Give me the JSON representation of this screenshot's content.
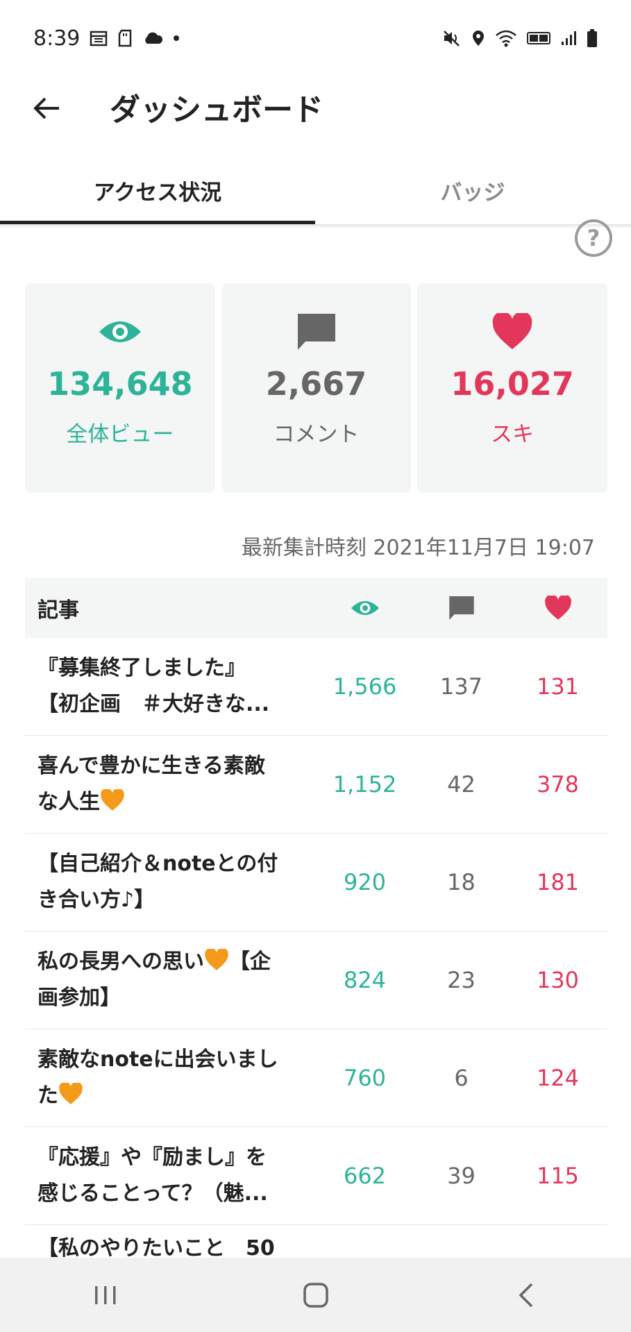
{
  "status_bar": {
    "time": "8:39"
  },
  "header": {
    "title": "ダッシュボード"
  },
  "tabs": [
    {
      "label": "アクセス状況",
      "active": true
    },
    {
      "label": "バッジ",
      "active": false
    }
  ],
  "stats": {
    "views": {
      "value": "134,648",
      "label": "全体ビュー",
      "color": "#2eb398",
      "icon": "eye-icon"
    },
    "comments": {
      "value": "2,667",
      "label": "コメント",
      "color": "#666666",
      "icon": "comment-icon"
    },
    "likes": {
      "value": "16,027",
      "label": "スキ",
      "color": "#e2365b",
      "icon": "heart-icon"
    }
  },
  "updated_text": "最新集計時刻 2021年11月7日 19:07",
  "table": {
    "header_title": "記事",
    "rows": [
      {
        "title_line1": "『募集終了しました』",
        "title_line2": "【初企画　＃大好きな...",
        "views": "1,566",
        "comments": "137",
        "likes": "131"
      },
      {
        "title_line1": "喜んで豊かに生きる素敵",
        "title_line2": "な人生",
        "views": "1,152",
        "comments": "42",
        "likes": "378"
      },
      {
        "title_line1": "【自己紹介＆noteとの付",
        "title_line2": "き合い方♪】",
        "views": "920",
        "comments": "18",
        "likes": "181"
      },
      {
        "title_line1": "私の長男への思い",
        "title_line2": "画参加】",
        "views": "824",
        "comments": "23",
        "likes": "130"
      },
      {
        "title_line1": "素敵なnoteに出会いまし",
        "title_line2": "た",
        "views": "760",
        "comments": "6",
        "likes": "124"
      },
      {
        "title_line1": "『応援』や『励まし』を",
        "title_line2": "感じることって？（魅...",
        "views": "662",
        "comments": "39",
        "likes": "115"
      },
      {
        "title_line1": "【私のやりたいこと　50"
      }
    ],
    "row4_suffix": "【企"
  },
  "colors": {
    "green": "#2eb398",
    "red": "#e2365b",
    "gray": "#666666",
    "orange_heart": "#f39a1a"
  }
}
